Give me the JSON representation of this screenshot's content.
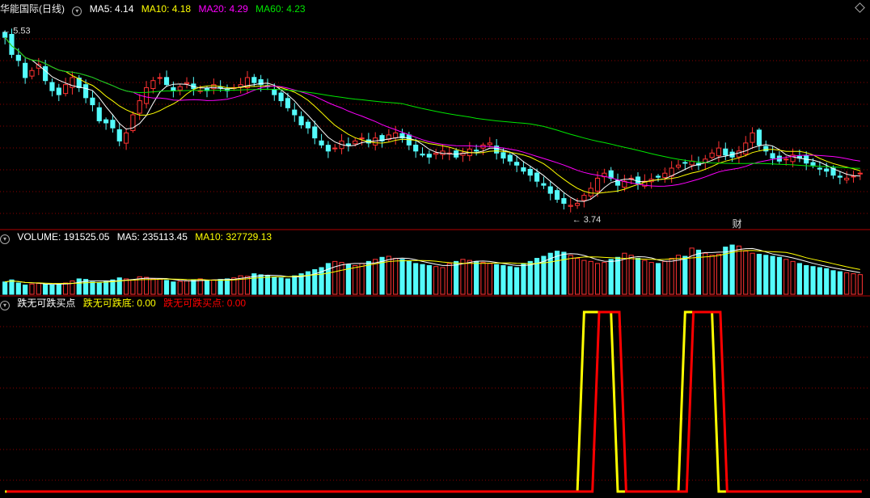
{
  "price_panel": {
    "title": "华能国际(日线)",
    "ma5": "MA5: 4.14",
    "ma10": "MA10: 4.18",
    "ma20": "MA20: 4.29",
    "ma60": "MA60: 4.23",
    "high_label": "5.53",
    "low_label": "3.74",
    "event_marker": "财"
  },
  "volume_panel": {
    "title": "VOLUME: 191525.05",
    "ma5": "MA5: 235113.45",
    "ma10": "MA10: 327729.13"
  },
  "indicator_panel": {
    "title": "跌无可跌买点",
    "line1": "跌无可跌底: 0.00",
    "line2": "跌无可跌买点: 0.00"
  },
  "colors": {
    "up": "#ff3232",
    "down": "#54fcfc",
    "ma5": "#ffffff",
    "ma10": "#ffff00",
    "ma20": "#ff00ff",
    "ma60": "#00e600",
    "signal_yellow": "#ffff00",
    "signal_red": "#ff0000",
    "grid": "#8b0000"
  },
  "chart_data": {
    "type": "candlestick",
    "price_high_marker": 5.53,
    "price_low_marker": 3.74,
    "closes": [
      5.45,
      5.28,
      5.22,
      5.05,
      5.12,
      5.18,
      5.02,
      4.92,
      4.88,
      4.98,
      5.05,
      4.95,
      4.85,
      4.78,
      4.62,
      4.6,
      4.55,
      4.42,
      4.5,
      4.68,
      4.82,
      4.95,
      5.02,
      5.05,
      4.98,
      4.92,
      4.96,
      5.0,
      4.94,
      4.92,
      4.92,
      4.98,
      4.95,
      4.92,
      4.95,
      4.98,
      5.05,
      5.0,
      4.98,
      4.96,
      4.88,
      4.82,
      4.75,
      4.68,
      4.58,
      4.55,
      4.45,
      4.38,
      4.32,
      4.35,
      4.42,
      4.38,
      4.42,
      4.45,
      4.4,
      4.45,
      4.42,
      4.48,
      4.5,
      4.45,
      4.38,
      4.32,
      4.28,
      4.26,
      4.3,
      4.32,
      4.3,
      4.26,
      4.3,
      4.34,
      4.32,
      4.38,
      4.4,
      4.3,
      4.25,
      4.22,
      4.18,
      4.12,
      4.08,
      4.02,
      3.98,
      3.9,
      3.84,
      3.8,
      3.78,
      3.8,
      3.88,
      3.95,
      4.05,
      4.1,
      4.05,
      3.98,
      4.02,
      4.05,
      4.0,
      4.02,
      4.04,
      4.06,
      4.1,
      4.15,
      4.18,
      4.2,
      4.22,
      4.18,
      4.24,
      4.3,
      4.35,
      4.28,
      4.26,
      4.32,
      4.4,
      4.5,
      4.38,
      4.32,
      4.25,
      4.22,
      4.24,
      4.28,
      4.25,
      4.2,
      4.18,
      4.14,
      4.12,
      4.08,
      4.06,
      4.05,
      4.07,
      4.1
    ],
    "volumes": [
      120000,
      140000,
      110000,
      90000,
      100000,
      105000,
      95000,
      92000,
      100000,
      110000,
      130000,
      150000,
      145000,
      120000,
      110000,
      130000,
      140000,
      160000,
      150000,
      140000,
      170000,
      165000,
      150000,
      148000,
      135000,
      120000,
      125000,
      130000,
      140000,
      150000,
      135000,
      140000,
      145000,
      150000,
      160000,
      180000,
      175000,
      200000,
      190000,
      185000,
      170000,
      160000,
      150000,
      180000,
      200000,
      220000,
      240000,
      260000,
      300000,
      320000,
      310000,
      290000,
      280000,
      300000,
      320000,
      340000,
      360000,
      370000,
      350000,
      340000,
      320000,
      300000,
      290000,
      280000,
      270000,
      260000,
      300000,
      320000,
      340000,
      330000,
      320000,
      310000,
      300000,
      290000,
      280000,
      270000,
      260000,
      300000,
      320000,
      350000,
      370000,
      400000,
      420000,
      410000,
      380000,
      350000,
      330000,
      320000,
      300000,
      310000,
      340000,
      360000,
      400000,
      380000,
      350000,
      330000,
      310000,
      300000,
      320000,
      350000,
      380000,
      370000,
      450000,
      430000,
      400000,
      380000,
      390000,
      460000,
      480000,
      470000,
      420000,
      400000,
      390000,
      380000,
      370000,
      360000,
      340000,
      320000,
      300000,
      280000,
      270000,
      260000,
      250000,
      230000,
      220000,
      210000,
      200000,
      191525
    ],
    "signal_line_yellow": "zero except spikes around bars 86-90 and 101-105",
    "signal_line_red": "zero except spikes around bars 88-91 and 102-106"
  }
}
